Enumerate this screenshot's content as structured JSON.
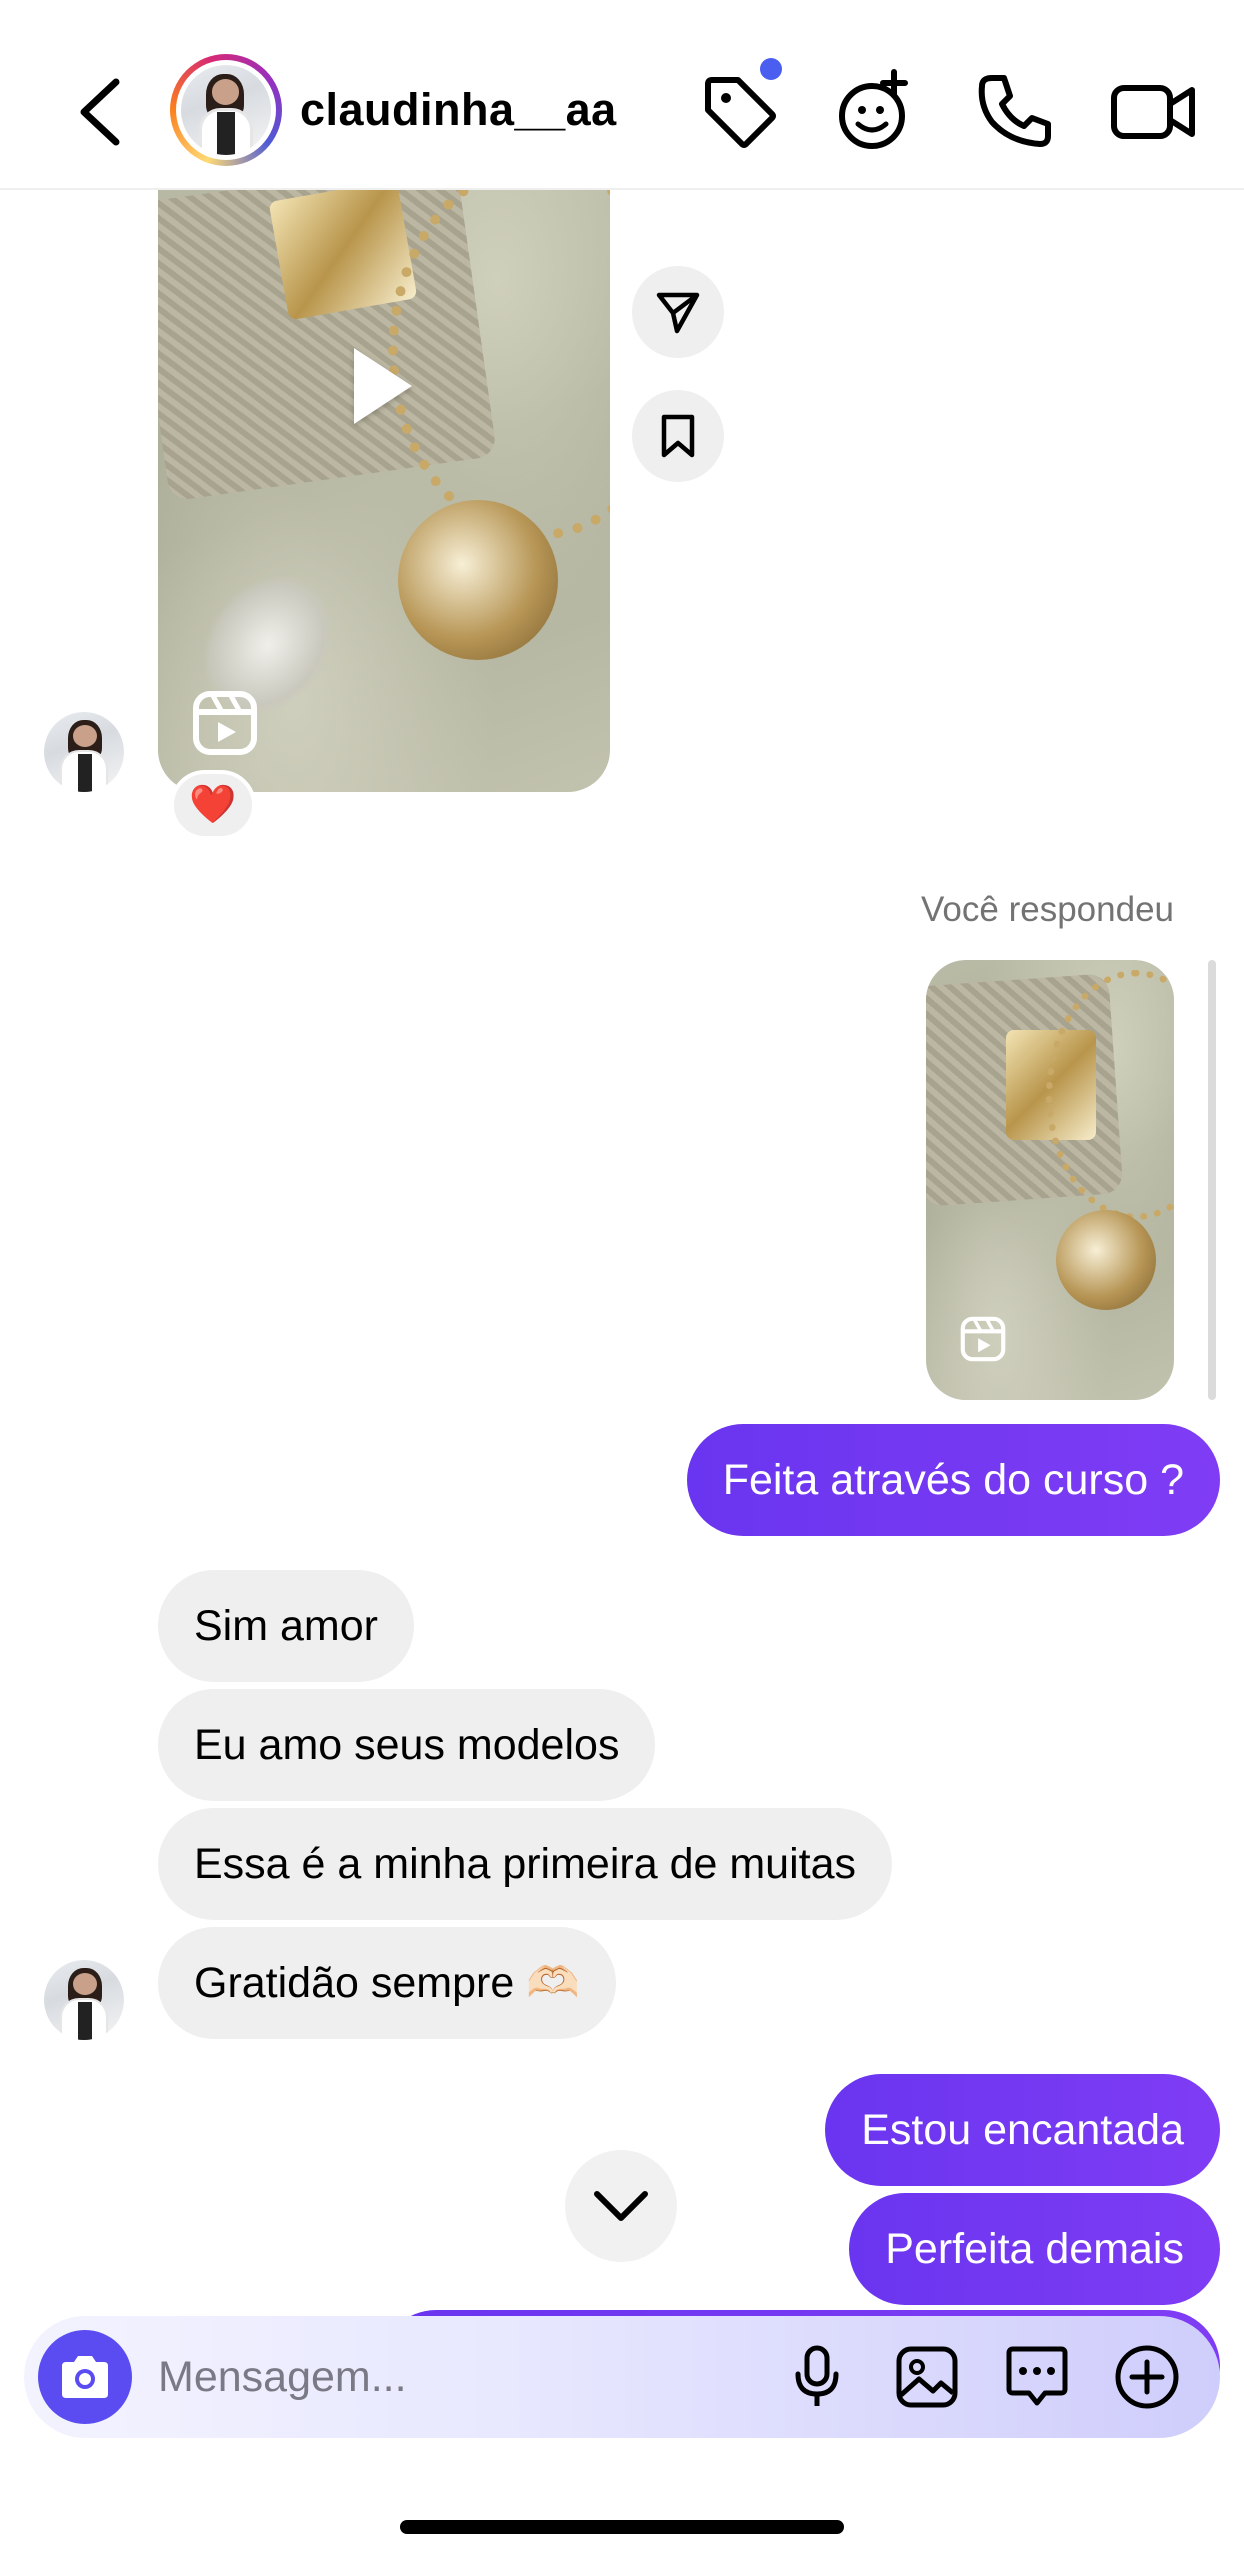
{
  "header": {
    "username": "claudinha__aa",
    "icons": [
      "back-chevron-icon",
      "tag-icon",
      "effects-face-icon",
      "phone-icon",
      "video-camera-icon"
    ],
    "notification_dot_color": "#4a5ef0"
  },
  "thread": {
    "shared_reel": {
      "icons": [
        "play-icon",
        "reels-icon",
        "share-send-icon",
        "bookmark-icon"
      ],
      "reaction": "❤️"
    },
    "reply_meta": "Você respondeu",
    "messages_out_1": [
      "Feita através do curso ?"
    ],
    "messages_in": [
      "Sim amor",
      "Eu amo seus modelos",
      "Essa é a minha primeira de muitas",
      "Gratidão sempre 🫶🏻"
    ],
    "messages_out_2": [
      "Estou encantada",
      "Perfeita demais"
    ]
  },
  "composer": {
    "placeholder": "Mensagem...",
    "icons": [
      "camera-icon",
      "microphone-icon",
      "gallery-icon",
      "sticker-chat-icon",
      "plus-icon"
    ]
  },
  "colors": {
    "outgoing_bubble": "#6a35f0",
    "incoming_bubble": "#efefef",
    "camera_button": "#5b4cf2"
  }
}
